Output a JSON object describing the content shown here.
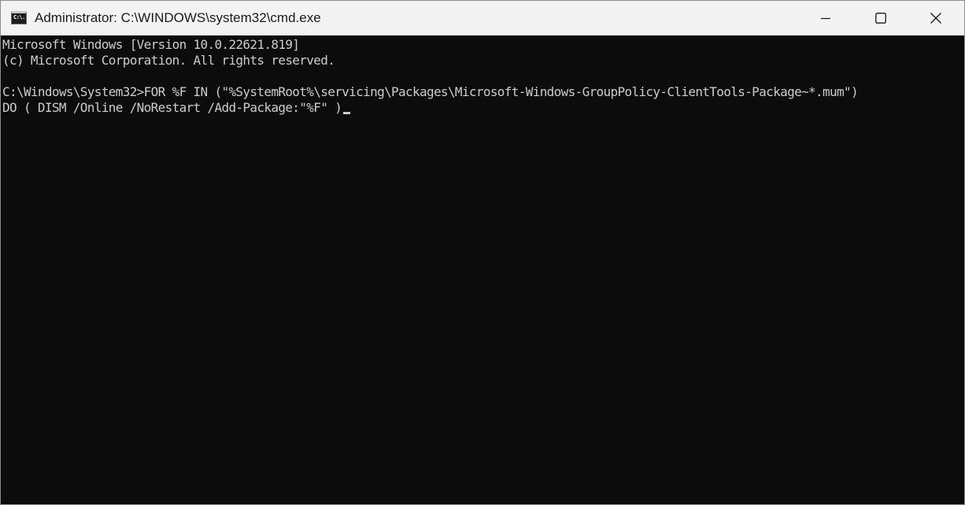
{
  "window": {
    "title": "Administrator: C:\\WINDOWS\\system32\\cmd.exe",
    "icon_text": "C:\\.",
    "icon": "cmd-icon",
    "controls": {
      "minimize": "minimize-icon",
      "maximize": "maximize-icon",
      "close": "close-icon"
    }
  },
  "console": {
    "lines": [
      "Microsoft Windows [Version 10.0.22621.819]",
      "(c) Microsoft Corporation. All rights reserved.",
      "",
      "C:\\Windows\\System32>FOR %F IN (\"%SystemRoot%\\servicing\\Packages\\Microsoft-Windows-GroupPolicy-ClientTools-Package~*.mum\")",
      "DO ( DISM /Online /NoRestart /Add-Package:\"%F\" )"
    ]
  },
  "colors": {
    "console_background": "#0c0c0c",
    "console_text": "#cccccc",
    "titlebar_background": "#f3f3f3"
  }
}
